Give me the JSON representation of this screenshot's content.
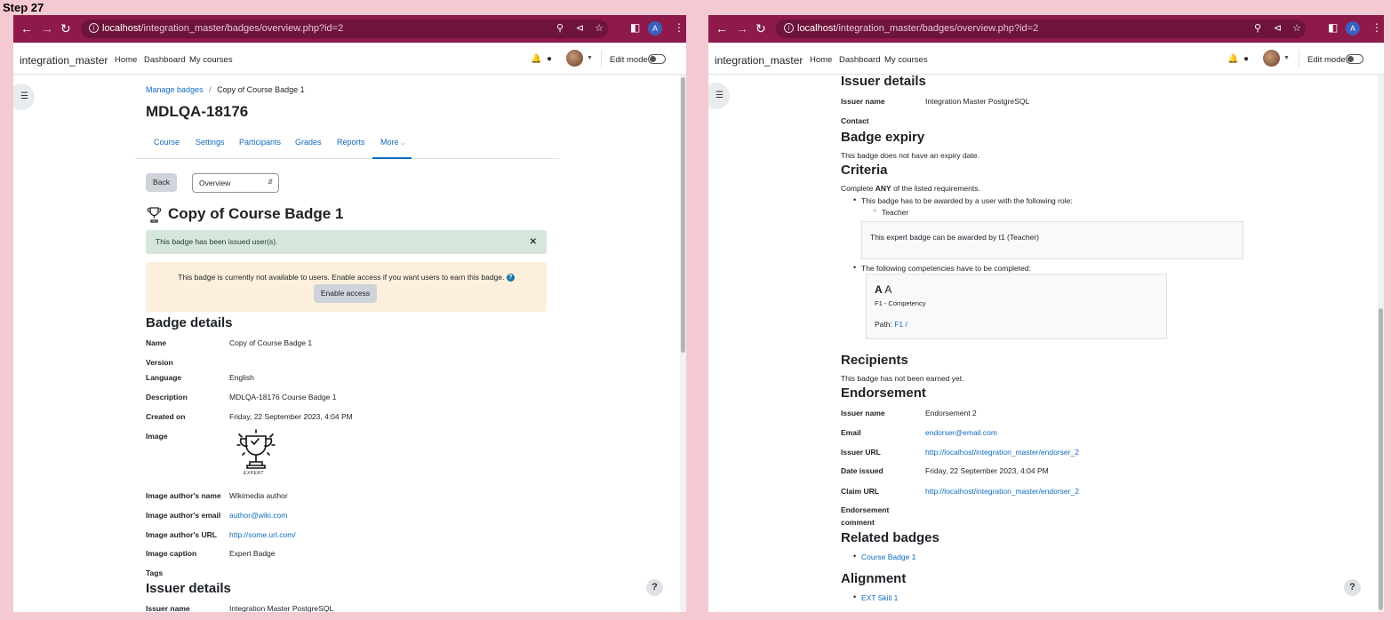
{
  "step_label": "Step 27",
  "browser": {
    "url_host": "localhost",
    "url_path": "/integration_master/badges/overview.php?id=2",
    "profile_initial": "A"
  },
  "moodle_nav": {
    "site_name": "integration_master",
    "links": [
      "Home",
      "Dashboard",
      "My courses"
    ],
    "edit_mode_label": "Edit mode"
  },
  "left": {
    "breadcrumb": {
      "parent": "Manage badges",
      "sep": "/",
      "current": "Copy of Course Badge 1"
    },
    "course_title": "MDLQA-18176",
    "tabs": [
      "Course",
      "Settings",
      "Participants",
      "Grades",
      "Reports",
      "More"
    ],
    "back_label": "Back",
    "select_value": "Overview",
    "badge_title": "Copy of Course Badge 1",
    "alert_success": "This badge has been issued user(s).",
    "alert_warning": "This badge is currently not available to users. Enable access if you want users to earn this badge.",
    "enable_access_label": "Enable access",
    "details_heading": "Badge details",
    "details": {
      "name_label": "Name",
      "name_value": "Copy of Course Badge 1",
      "version_label": "Version",
      "language_label": "Language",
      "language_value": "English",
      "description_label": "Description",
      "description_value": "MDLQA-18176 Course Badge 1",
      "created_label": "Created on",
      "created_value": "Friday, 22 September 2023, 4:04 PM",
      "image_label": "Image",
      "image_caption_text": "EXPERT",
      "author_name_label": "Image author's name",
      "author_name_value": "Wikimedia author",
      "author_email_label": "Image author's email",
      "author_email_value": "author@wiki.com",
      "author_url_label": "Image author's URL",
      "author_url_value": "http://some.url.com/",
      "caption_label": "Image caption",
      "caption_value": "Expert Badge",
      "tags_label": "Tags"
    },
    "issuer_heading": "Issuer details",
    "issuer_name_label": "Issuer name",
    "issuer_name_value": "Integration Master PostgreSQL"
  },
  "right": {
    "issuer_heading": "Issuer details",
    "issuer_name_label": "Issuer name",
    "issuer_name_value": "Integration Master PostgreSQL",
    "contact_label": "Contact",
    "expiry_heading": "Badge expiry",
    "expiry_text": "This badge does not have an expiry date.",
    "criteria_heading": "Criteria",
    "criteria_intro_pre": "Complete ",
    "criteria_intro_bold": "ANY",
    "criteria_intro_post": " of the listed requirements.",
    "criteria_role_text": "This badge has to be awarded by a user with the following role:",
    "criteria_role_item": "Teacher",
    "criteria_role_box": "This expert badge can be awarded by t1 (Teacher)",
    "criteria_comp_text": "The following competencies have to be completed:",
    "comp_title_bold": "A",
    "comp_title_rest": " A",
    "comp_framework": "F1 - Competency",
    "comp_path_label": "Path:",
    "comp_path_link": "F1 /",
    "recipients_heading": "Recipients",
    "recipients_text": "This badge has not been earned yet.",
    "endorsement_heading": "Endorsement",
    "endorsement": {
      "issuer_name_label": "Issuer name",
      "issuer_name_value": "Endorsement 2",
      "email_label": "Email",
      "email_value": "endorser@email.com",
      "issuer_url_label": "Issuer URL",
      "issuer_url_value": "http://localhost/integration_master/endorser_2",
      "date_label": "Date issued",
      "date_value": "Friday, 22 September 2023, 4:04 PM",
      "claim_label": "Claim URL",
      "claim_value": "http://localhost/integration_master/endorser_2",
      "comment_label_1": "Endorsement",
      "comment_label_2": "comment"
    },
    "related_heading": "Related badges",
    "related_item": "Course Badge 1",
    "alignment_heading": "Alignment",
    "alignment_item": "EXT Skill 1"
  },
  "help_label": "?"
}
